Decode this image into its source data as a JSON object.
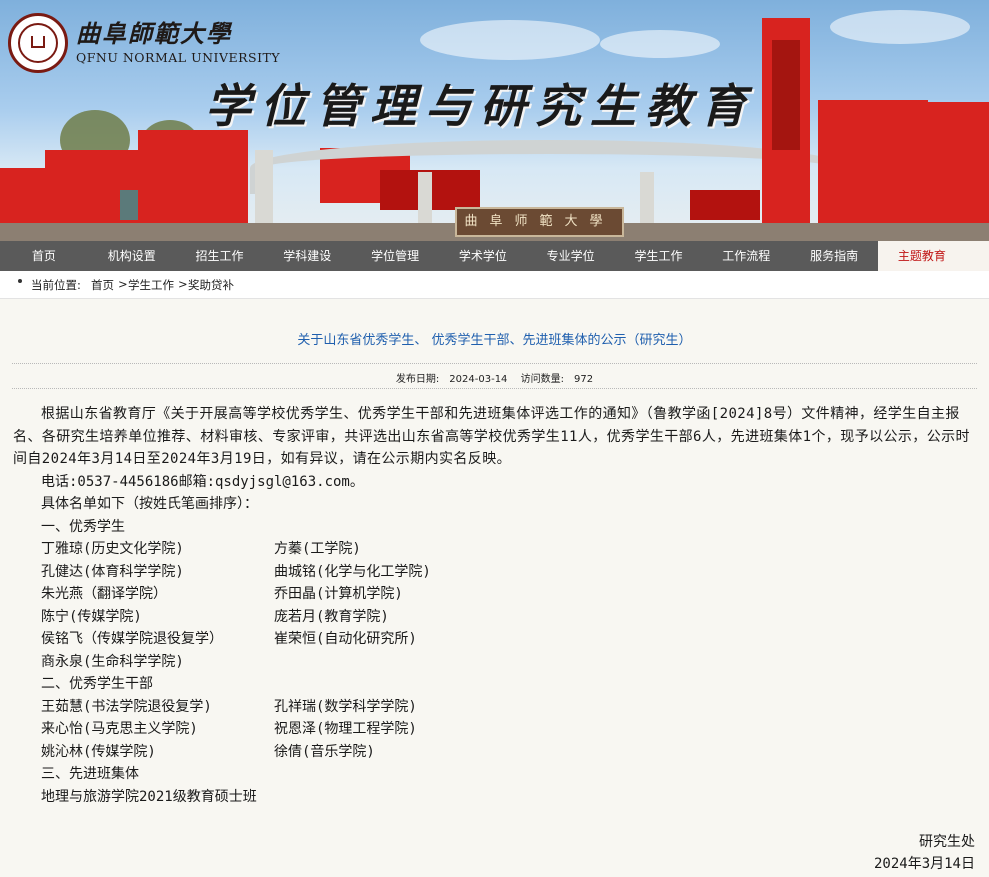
{
  "colors": {
    "nav_bg": "#5a5a5a",
    "nav_active_text": "#c01515",
    "title_blue": "#1f5fae",
    "content_bg": "#f8f7f2",
    "brand_red": "#d8231f"
  },
  "header": {
    "logo_cn": "曲阜師範大學",
    "logo_en": "QFNU NORMAL UNIVERSITY",
    "banner_title": "学位管理与研究生教育",
    "gate_sign": "曲阜师範大學"
  },
  "nav": {
    "items": [
      "首页",
      "机构设置",
      "招生工作",
      "学科建设",
      "学位管理",
      "学术学位",
      "专业学位",
      "学生工作",
      "工作流程",
      "服务指南",
      "主题教育"
    ],
    "active_index": 10
  },
  "breadcrumb": {
    "label": "当前位置:",
    "items": [
      "首页",
      "学生工作",
      "奖助贷补"
    ],
    "sep": ">"
  },
  "article": {
    "title": "关于山东省优秀学生、 优秀学生干部、先进班集体的公示（研究生）",
    "date_label": "发布日期:",
    "date": "2024-03-14",
    "views_label": "访问数量:",
    "views": "972",
    "intro": "根据山东省教育厅《关于开展高等学校优秀学生、优秀学生干部和先进班集体评选工作的通知》（鲁教学函[2024]8号）文件精神，经学生自主报名、各研究生培养单位推荐、材料审核、专家评审，共评选出山东省高等学校优秀学生11人，优秀学生干部6人，先进班集体1个，现予以公示，公示时间自2024年3月14日至2024年3月19日，如有异议，请在公示期内实名反映。",
    "contact": "电话:0537-4456186邮箱:qsdyjsgl@163.com。",
    "list_intro": "具体名单如下（按姓氏笔画排序）：",
    "sec1": "一、优秀学生",
    "sec1_rows": [
      [
        "丁雅琼(历史文化学院)",
        "方蓁(工学院)"
      ],
      [
        "孔健达(体育科学学院)",
        "曲城铭(化学与化工学院)"
      ],
      [
        "朱光燕（翻译学院）",
        "乔田晶(计算机学院)"
      ],
      [
        "陈宁(传媒学院)",
        "庞若月(教育学院)"
      ],
      [
        "侯铭飞（传媒学院退役复学）",
        "崔荣恒(自动化研究所)"
      ],
      [
        "商永泉(生命科学学院)",
        ""
      ]
    ],
    "sec2": "二、优秀学生干部",
    "sec2_rows": [
      [
        "王茹慧(书法学院退役复学)",
        "孔祥瑞(数学科学学院)"
      ],
      [
        "来心怡(马克思主义学院)",
        "祝恩泽(物理工程学院)"
      ],
      [
        "姚沁林(传媒学院)",
        "徐倩(音乐学院)"
      ]
    ],
    "sec3": "三、先进班集体",
    "sec3_item": "地理与旅游学院2021级教育硕士班",
    "sign_org": "研究生处",
    "sign_date": "2024年3月14日"
  }
}
